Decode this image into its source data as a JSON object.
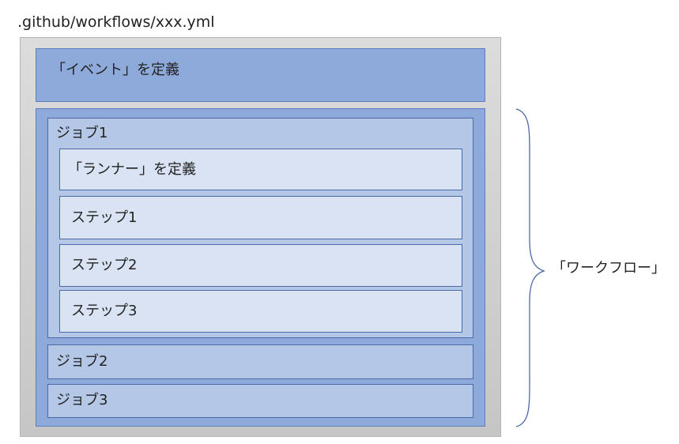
{
  "file_path": ".github/workflows/xxx.yml",
  "event": "「イベント」を定義",
  "jobs": [
    {
      "title": "ジョブ1",
      "steps": {
        "runner": "「ランナー」を定義",
        "step1": "ステップ1",
        "step2": "ステップ2",
        "step3": "ステップ3"
      }
    },
    {
      "title": "ジョブ2"
    },
    {
      "title": "ジョブ3"
    }
  ],
  "workflow_label": "「ワークフロー」",
  "colors": {
    "file_box": "#d0d0d0",
    "outer_blue": "#8eaadb",
    "job_blue": "#b4c7e7",
    "step_blue": "#dae3f3",
    "border_blue": "#4a6aa5"
  }
}
